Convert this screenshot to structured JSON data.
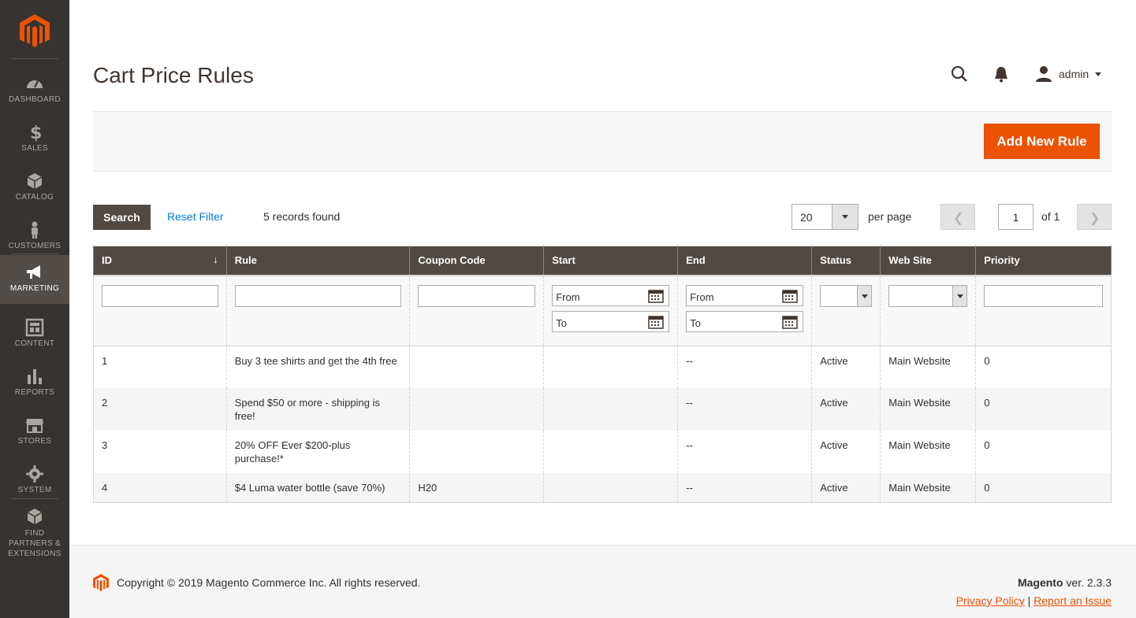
{
  "sidebar": {
    "items": [
      {
        "label": "Dashboard",
        "icon": "dashboard-icon"
      },
      {
        "label": "Sales",
        "icon": "dollar-icon"
      },
      {
        "label": "Catalog",
        "icon": "box-icon"
      },
      {
        "label": "Customers",
        "icon": "person-icon"
      },
      {
        "label": "Marketing",
        "icon": "megaphone-icon"
      },
      {
        "label": "Content",
        "icon": "layout-icon"
      },
      {
        "label": "Reports",
        "icon": "bar-chart-icon"
      },
      {
        "label": "Stores",
        "icon": "store-icon"
      },
      {
        "label": "System",
        "icon": "gear-icon"
      },
      {
        "label": "Find Partners & Extensions",
        "icon": "extensions-icon"
      }
    ],
    "active": "Marketing"
  },
  "header": {
    "title": "Cart Price Rules",
    "user": "admin"
  },
  "actions": {
    "add_new_rule": "Add New Rule"
  },
  "grid_controls": {
    "search": "Search",
    "reset_filter": "Reset Filter",
    "records_found": "5 records found",
    "per_page_value": "20",
    "per_page_label": "per page",
    "current_page": "1",
    "of_pages": "of 1"
  },
  "table": {
    "columns": [
      "ID",
      "Rule",
      "Coupon Code",
      "Start",
      "End",
      "Status",
      "Web Site",
      "Priority"
    ],
    "filters": {
      "from_placeholder": "From",
      "to_placeholder": "To"
    },
    "rows": [
      {
        "id": "1",
        "rule": "Buy 3 tee shirts and get the 4th free",
        "coupon": "",
        "start": "",
        "end": "--",
        "status": "Active",
        "website": "Main Website",
        "priority": "0"
      },
      {
        "id": "2",
        "rule": "Spend $50 or more - shipping is free!",
        "coupon": "",
        "start": "",
        "end": "--",
        "status": "Active",
        "website": "Main Website",
        "priority": "0"
      },
      {
        "id": "3",
        "rule": "20% OFF Ever $200-plus purchase!*",
        "coupon": "",
        "start": "",
        "end": "--",
        "status": "Active",
        "website": "Main Website",
        "priority": "0"
      },
      {
        "id": "4",
        "rule": "$4 Luma water bottle (save 70%)",
        "coupon": "H20",
        "start": "",
        "end": "--",
        "status": "Active",
        "website": "Main Website",
        "priority": "0"
      }
    ]
  },
  "footer": {
    "copyright": "Copyright © 2019 Magento Commerce Inc. All rights reserved.",
    "brand": "Magento",
    "version": " ver. 2.3.3",
    "privacy": "Privacy Policy",
    "separator": " | ",
    "report": "Report an Issue"
  },
  "colors": {
    "sidebar_bg": "#373330",
    "accent": "#eb5202",
    "header_row": "#514943",
    "link": "#007bdb"
  }
}
